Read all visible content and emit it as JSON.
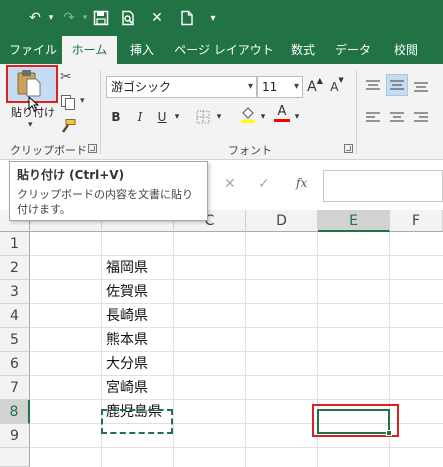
{
  "qat": {
    "undo": "↶",
    "redo": "↷",
    "save": "💾",
    "preview": "🔍",
    "close": "✕",
    "new": "🗋",
    "customize": "▾"
  },
  "tabs": [
    {
      "label": "ファイル"
    },
    {
      "label": "ホーム"
    },
    {
      "label": "挿入"
    },
    {
      "label": "ページ レイアウト"
    },
    {
      "label": "数式"
    },
    {
      "label": "データ"
    },
    {
      "label": "校閲"
    }
  ],
  "clipboard": {
    "paste_label": "貼り付け",
    "group_label": "クリップボード"
  },
  "font": {
    "name": "游ゴシック",
    "size": "11",
    "grow": "A",
    "shrink": "A",
    "bold": "B",
    "italic": "I",
    "underline": "U",
    "color_letter": "A",
    "group_label": "フォント"
  },
  "tooltip": {
    "title": "貼り付け (Ctrl+V)",
    "description": "クリップボードの内容を文書に貼り付けます。"
  },
  "formula_bar": {
    "cancel": "✕",
    "enter": "✓",
    "fx": "fx",
    "value": ""
  },
  "sheet": {
    "columns": [
      "C",
      "D",
      "E",
      "F"
    ],
    "column_b_label": "",
    "rows": [
      "1",
      "2",
      "3",
      "4",
      "5",
      "6",
      "7",
      "8",
      "9"
    ],
    "cells": {
      "B2": "福岡県",
      "B3": "佐賀県",
      "B4": "長崎県",
      "B5": "熊本県",
      "B6": "大分県",
      "B7": "宮崎県",
      "B8": "鹿児島県"
    },
    "selected_cell": "E8",
    "copy_marquee_cell": "B8"
  },
  "colors": {
    "accent": "#217346",
    "highlight_box": "#e02020",
    "font_color_bar": "#ff0000"
  }
}
